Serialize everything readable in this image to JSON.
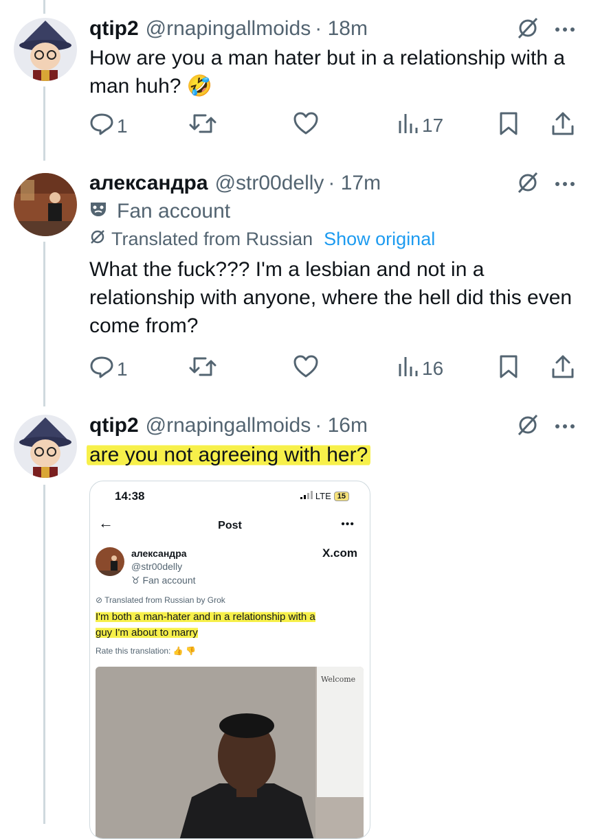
{
  "tweets": [
    {
      "display_name": "qtip2",
      "handle": "@rnapingallmoids",
      "time": "· 18m",
      "text": "How are you a man hater but in a relationship with a man huh? 🤣",
      "replies": "1",
      "views": "17"
    },
    {
      "display_name": "александра",
      "handle": "@str00delly",
      "time": "· 17m",
      "fan_label": "Fan account",
      "translated_label": "Translated from Russian",
      "show_original": "Show original",
      "text": "What the fuck??? I'm a lesbian and not in a relationship with anyone, where the hell did this even come from?",
      "replies": "1",
      "views": "16"
    },
    {
      "display_name": "qtip2",
      "handle": "@rnapingallmoids",
      "time": "· 16m",
      "text": "are you not agreeing with her?"
    }
  ],
  "embedded": {
    "time": "14:38",
    "network": "LTE",
    "battery": "15",
    "title": "Post",
    "name": "александра",
    "handle": "@str00delly",
    "fan_label": "Fan account",
    "site": "X.com",
    "translated": "Translated from Russian by Grok",
    "text_line1": "I'm both a man-hater and in a relationship with a",
    "text_line2": "guy I'm about to marry",
    "rate": "Rate this translation:",
    "whiteboard": "Welcome"
  },
  "colors": {
    "text": "#0f1419",
    "secondary": "#536471",
    "link": "#1d9bf0",
    "highlight": "#f7f04a",
    "thread_line": "#cfd9de"
  },
  "icons": [
    "reply-icon",
    "repost-icon",
    "like-icon",
    "views-icon",
    "bookmark-icon",
    "share-icon",
    "grok-slash-icon",
    "more-icon",
    "mask-icon"
  ]
}
